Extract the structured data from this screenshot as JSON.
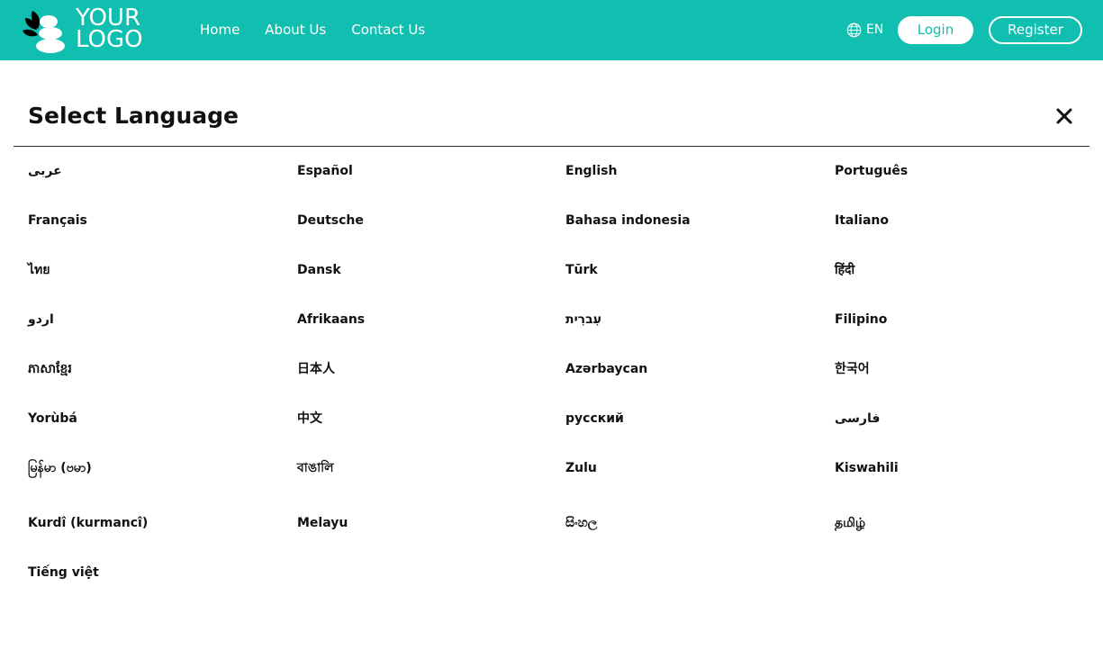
{
  "header": {
    "logo_line1": "YOUR",
    "logo_line2": "LOGO",
    "nav": [
      "Home",
      "About Us",
      "Contact Us"
    ],
    "language_code": "EN",
    "login_label": "Login",
    "register_label": "Register",
    "brand_color": "#10bfb0"
  },
  "modal": {
    "title": "Select Language",
    "close_icon": "close-icon",
    "languages": [
      "عربى",
      "Español",
      "English",
      "Português",
      "Français",
      "Deutsche",
      "Bahasa indonesia",
      "Italiano",
      "ไทย",
      "Dansk",
      "Tūrk",
      "हिंदी",
      "اردو",
      "Afrikaans",
      "עִברִית",
      "Filipino",
      "ភាសាខ្មែរ",
      "日本人",
      "Azərbaycan",
      "한국어",
      "Yorùbá",
      "中文",
      "русский",
      "فارسی",
      "မြန်မာ (ဗမာ)",
      "বাঙালি",
      "Zulu",
      "Kiswahili",
      "Kurdî (kurmancî)",
      "Melayu",
      "සිංහල",
      "தமிழ்",
      "Tiếng việt"
    ]
  }
}
